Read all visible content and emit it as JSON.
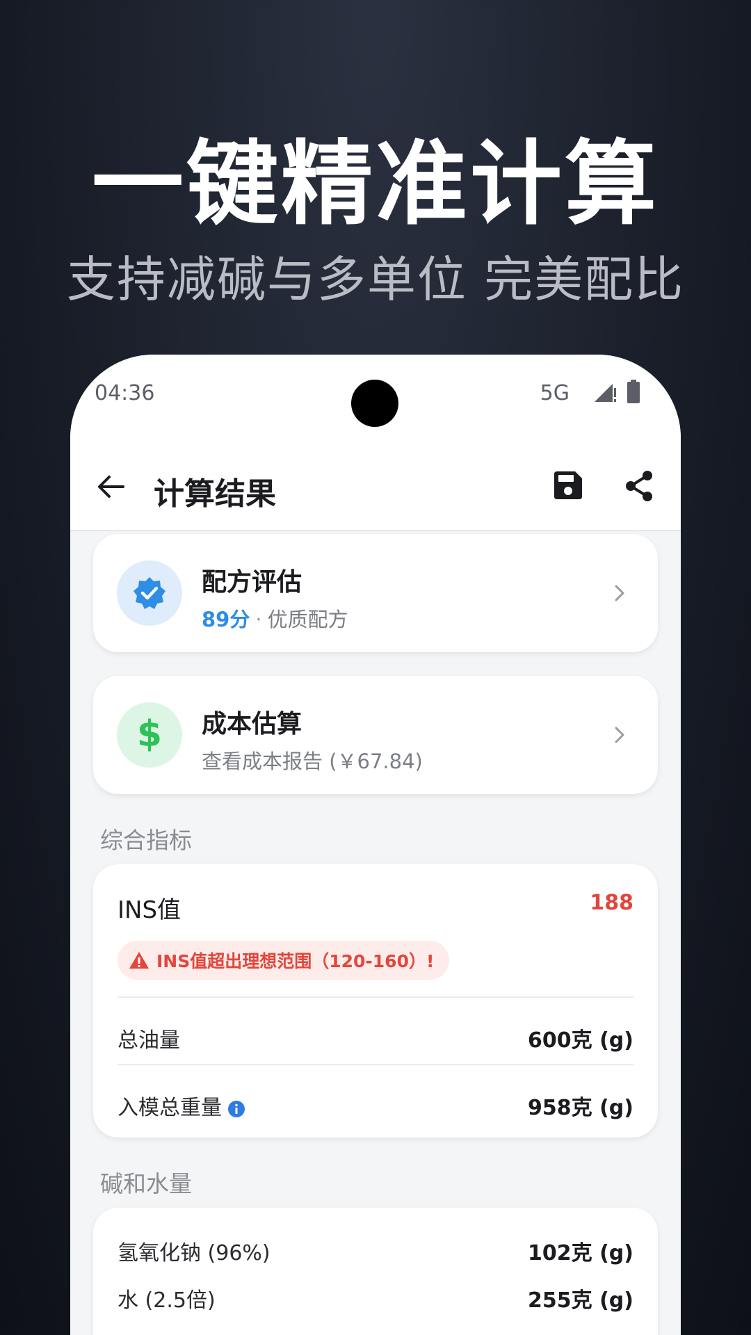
{
  "promo": {
    "headline": "一键精准计算",
    "subline": "支持减碱与多单位 完美配比"
  },
  "status_bar": {
    "time": "04:36",
    "network": "5G",
    "icons": [
      "signal-icon",
      "battery-icon"
    ]
  },
  "app_bar": {
    "title": "计算结果",
    "icons": [
      "back-arrow-icon",
      "save-icon",
      "share-icon"
    ]
  },
  "evaluation_card": {
    "title": "配方评估",
    "score": "89分",
    "separator": "·",
    "rating": "优质配方",
    "icon": "verified-badge-icon"
  },
  "cost_card": {
    "title": "成本估算",
    "subtitle": "查看成本报告 (￥67.84)",
    "icon": "dollar-icon",
    "icon_glyph": "$"
  },
  "overall": {
    "section_label": "综合指标",
    "ins_label": "INS值",
    "ins_value": "188",
    "warning": "INS值超出理想范围（120-160）!",
    "total_oil_label": "总油量",
    "total_oil_value": "600克 (g)",
    "mold_weight_label": "入模总重量",
    "mold_weight_value": "958克 (g)"
  },
  "lye_water": {
    "section_label": "碱和水量",
    "naoh_label": "氢氧化钠 (96%)",
    "naoh_value": "102克 (g)",
    "water_label": "水 (2.5倍)",
    "water_value": "255克 (g)"
  },
  "colors": {
    "accent_blue": "#2e8de4",
    "warning_red": "#e2463c",
    "success_green": "#2ec256"
  }
}
